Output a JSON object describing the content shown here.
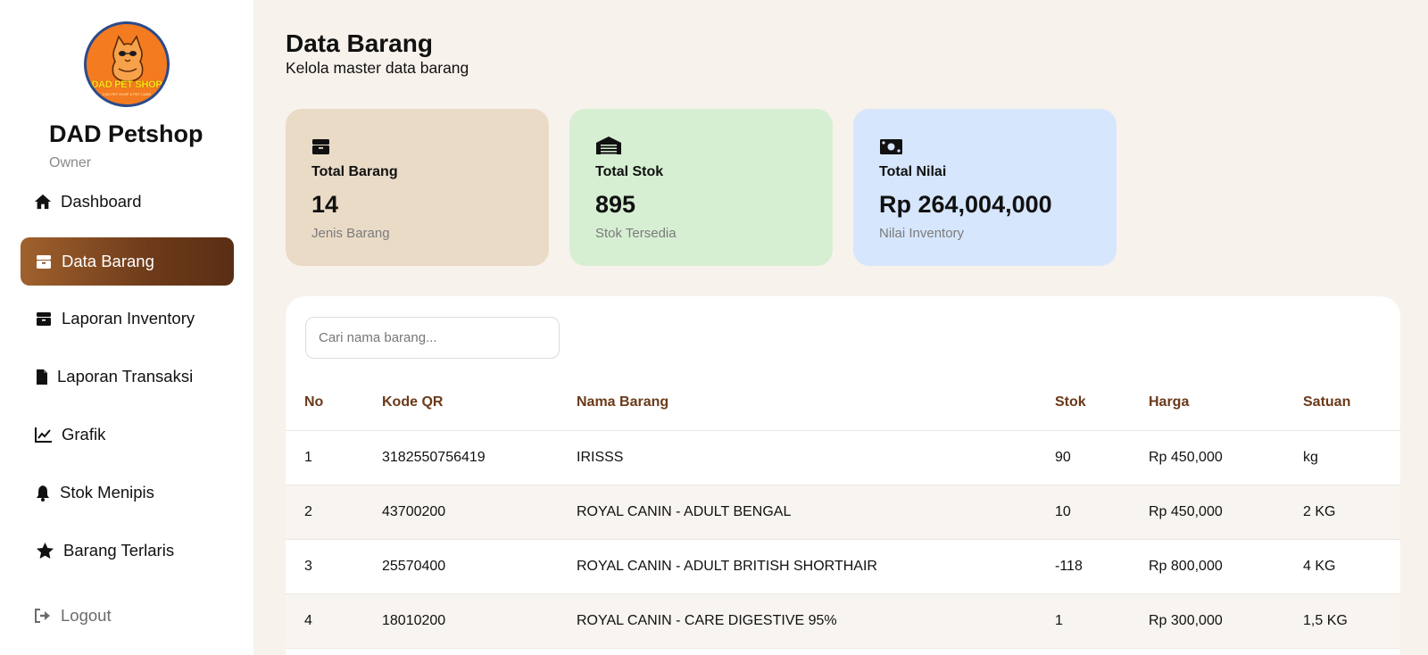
{
  "sidebar": {
    "logo": {
      "text": "DAD PET SHOP",
      "tagline": "DAD PET SHOP & PET CARE"
    },
    "brand": "DAD Petshop",
    "role": "Owner",
    "items": [
      {
        "label": "Dashboard",
        "icon": "home-icon"
      },
      {
        "label": "Data Barang",
        "icon": "box-icon",
        "active": true
      },
      {
        "label": "Laporan Inventory",
        "icon": "box-icon"
      },
      {
        "label": "Laporan Transaksi",
        "icon": "file-icon"
      },
      {
        "label": "Grafik",
        "icon": "chart-line-icon"
      },
      {
        "label": "Stok Menipis",
        "icon": "bell-icon"
      },
      {
        "label": "Barang Terlaris",
        "icon": "star-icon"
      }
    ],
    "logout": "Logout"
  },
  "header": {
    "title": "Data Barang",
    "subtitle": "Kelola master data barang"
  },
  "cards": [
    {
      "label": "Total Barang",
      "value": "14",
      "note": "Jenis Barang",
      "icon": "box-icon",
      "color": "#eadbc7"
    },
    {
      "label": "Total Stok",
      "value": "895",
      "note": "Stok Tersedia",
      "icon": "warehouse-icon",
      "color": "#d6efd2"
    },
    {
      "label": "Total Nilai",
      "value": "Rp 264,004,000",
      "note": "Nilai Inventory",
      "icon": "money-icon",
      "color": "#d6e6fd"
    }
  ],
  "search": {
    "placeholder": "Cari nama barang..."
  },
  "table": {
    "headers": [
      "No",
      "Kode QR",
      "Nama Barang",
      "Stok",
      "Harga",
      "Satuan"
    ],
    "rows": [
      [
        "1",
        "3182550756419",
        "IRISSS",
        "90",
        "Rp 450,000",
        "kg"
      ],
      [
        "2",
        "43700200",
        "ROYAL CANIN - ADULT BENGAL",
        "10",
        "Rp 450,000",
        "2 KG"
      ],
      [
        "3",
        "25570400",
        "ROYAL CANIN - ADULT BRITISH SHORTHAIR",
        "-118",
        "Rp 800,000",
        "4 KG"
      ],
      [
        "4",
        "18010200",
        "ROYAL CANIN - CARE DIGESTIVE 95%",
        "1",
        "Rp 300,000",
        "1,5 KG"
      ]
    ]
  },
  "colors": {
    "accent": "#6e3b1a",
    "header_text": "#6b3a1a",
    "background": "#f7f2ec"
  }
}
